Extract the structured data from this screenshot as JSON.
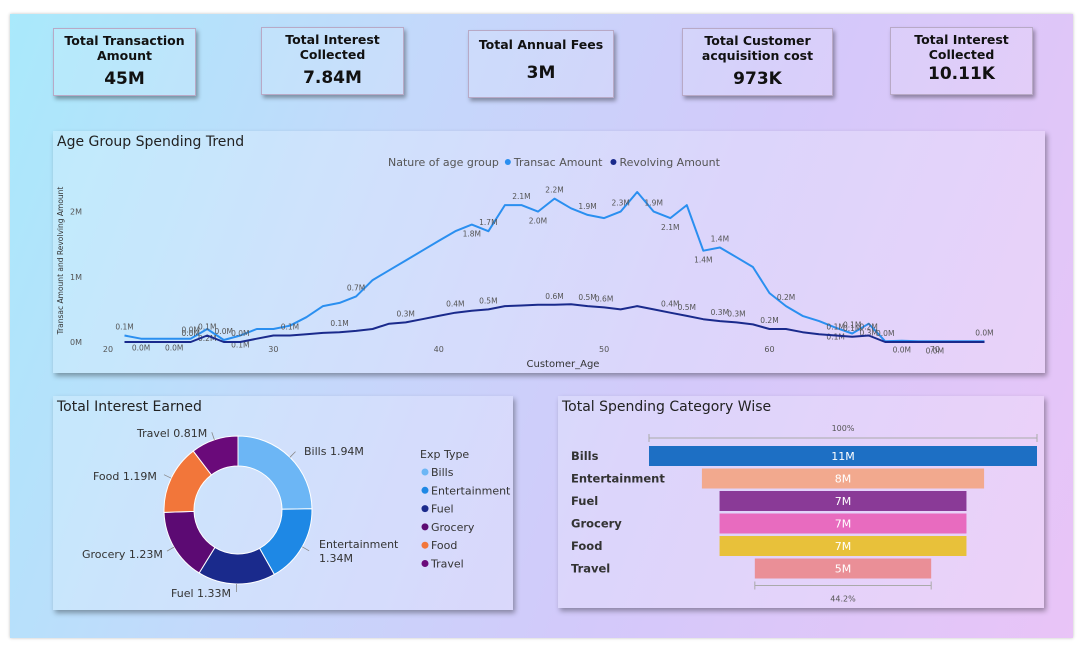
{
  "kpis": [
    {
      "label": "Total Transaction\nAmount",
      "value": "45M"
    },
    {
      "label": "Total Interest\nCollected",
      "value": "7.84M"
    },
    {
      "label": "Total Annual Fees",
      "value": "3M"
    },
    {
      "label": "Total Customer\nacquisition cost",
      "value": "973K"
    },
    {
      "label": "Total Interest\nCollected",
      "value": "10.11K"
    }
  ],
  "colors": {
    "transac": "#2a8ff0",
    "revolving": "#1a2a8c",
    "panel_shadow": "#000000"
  },
  "chart_data": [
    {
      "type": "line",
      "title": "Age Group Spending Trend",
      "legend_title": "Nature of age group",
      "legend_position": "top-center",
      "xlabel": "Customer_Age",
      "ylabel": "Transac Amount and Revolving Amount",
      "xlim": [
        20,
        74
      ],
      "ylim": [
        0,
        2.5
      ],
      "x_ticks": [
        20,
        30,
        40,
        50,
        60,
        70
      ],
      "y_ticks": [
        {
          "v": 0,
          "label": "0M"
        },
        {
          "v": 1,
          "label": "1M"
        },
        {
          "v": 2,
          "label": "2M"
        }
      ],
      "x": [
        21,
        22,
        23,
        24,
        25,
        26,
        27,
        28,
        29,
        30,
        31,
        32,
        33,
        34,
        35,
        36,
        37,
        38,
        39,
        40,
        41,
        42,
        43,
        44,
        45,
        46,
        47,
        48,
        49,
        50,
        51,
        52,
        53,
        54,
        55,
        56,
        57,
        58,
        59,
        60,
        61,
        62,
        63,
        64,
        65,
        66,
        67,
        68,
        69,
        70,
        71,
        72,
        73
      ],
      "series": [
        {
          "name": "Transac Amount",
          "color": "#2a8ff0",
          "values": [
            0.1,
            0.05,
            0.05,
            0.05,
            0.05,
            0.2,
            0.03,
            0.1,
            0.2,
            0.2,
            0.25,
            0.38,
            0.55,
            0.6,
            0.7,
            0.95,
            1.1,
            1.25,
            1.4,
            1.55,
            1.7,
            1.8,
            1.7,
            2.1,
            2.1,
            2.0,
            2.2,
            2.05,
            1.95,
            1.9,
            2.0,
            2.3,
            2.0,
            1.9,
            2.1,
            1.4,
            1.45,
            1.3,
            1.15,
            0.75,
            0.55,
            0.4,
            0.32,
            0.22,
            0.13,
            0.28,
            0.01,
            0.02,
            0.01,
            0.01,
            0.01,
            0.01,
            0.01
          ],
          "point_labels": {
            "21": "0.1M",
            "22": "0.0M",
            "24": "0.0M",
            "25": "0.0M",
            "26": "0.2M",
            "27": "0.0M",
            "28": "0.1M",
            "35": "0.7M",
            "42": "1.8M",
            "43": "1.7M",
            "45": "2.1M",
            "46": "2.0M",
            "47": "2.2M",
            "49": "1.9M",
            "51": "2.3M",
            "53": "1.9M",
            "54": "2.1M",
            "56": "1.4M",
            "57": "1.4M",
            "61": "0.2M",
            "64": "0.1M",
            "65": "0.1M",
            "66": "0.3M",
            "68": "0.0M",
            "70": "0.0M",
            "73": "0.0M"
          }
        },
        {
          "name": "Revolving Amount",
          "color": "#1a2a8c",
          "values": [
            0.0,
            0.0,
            0.0,
            0.0,
            0.0,
            0.1,
            0.0,
            0.0,
            0.05,
            0.1,
            0.1,
            0.12,
            0.14,
            0.15,
            0.17,
            0.2,
            0.28,
            0.3,
            0.35,
            0.4,
            0.45,
            0.48,
            0.5,
            0.55,
            0.56,
            0.57,
            0.57,
            0.58,
            0.55,
            0.53,
            0.5,
            0.55,
            0.5,
            0.45,
            0.4,
            0.35,
            0.32,
            0.3,
            0.27,
            0.2,
            0.2,
            0.15,
            0.12,
            0.1,
            0.08,
            0.1,
            0.0,
            0.0,
            0.0,
            0.0,
            0.0,
            0.0,
            0.0
          ],
          "point_labels": {
            "25": "0.0M",
            "26": "0.1M",
            "28": "0.0M",
            "31": "0.1M",
            "34": "0.1M",
            "38": "0.3M",
            "41": "0.4M",
            "43": "0.5M",
            "47": "0.6M",
            "49": "0.5M",
            "50": "0.6M",
            "54": "0.4M",
            "55": "0.5M",
            "57": "0.3M",
            "58": "0.3M",
            "60": "0.2M",
            "64": "0.1M",
            "65": "0.1M",
            "66": "0.2M",
            "67": "0.0M"
          }
        }
      ]
    },
    {
      "type": "pie",
      "title": "Total Interest Earned",
      "legend_title": "Exp Type",
      "legend_position": "right",
      "labels": [
        "Bills",
        "Entertainment",
        "Fuel",
        "Grocery",
        "Food",
        "Travel"
      ],
      "values": [
        1.94,
        1.34,
        1.33,
        1.23,
        1.19,
        0.81
      ],
      "display_labels": [
        "Bills 1.94M",
        "Entertainment\n1.34M",
        "Fuel 1.33M",
        "Grocery 1.23M",
        "Food 1.19M",
        "Travel 0.81M"
      ],
      "colors": [
        "#6cb6f5",
        "#1e88e5",
        "#1a2a8c",
        "#5c0a73",
        "#f2763a",
        "#6a0a7a"
      ]
    },
    {
      "type": "bar",
      "subtype": "funnel",
      "title": "Total Spending Category Wise",
      "categories": [
        "Bills",
        "Entertainment",
        "Fuel",
        "Grocery",
        "Food",
        "Travel"
      ],
      "values": [
        11,
        8,
        7,
        7,
        7,
        5
      ],
      "value_labels": [
        "11M",
        "8M",
        "7M",
        "7M",
        "7M",
        "5M"
      ],
      "colors": [
        "#1d6fc4",
        "#f2a98e",
        "#8a3a97",
        "#e86bbf",
        "#e8c13a",
        "#ea8f97"
      ],
      "top_percent_label": "100%",
      "bottom_percent_label": "44.2%"
    }
  ]
}
